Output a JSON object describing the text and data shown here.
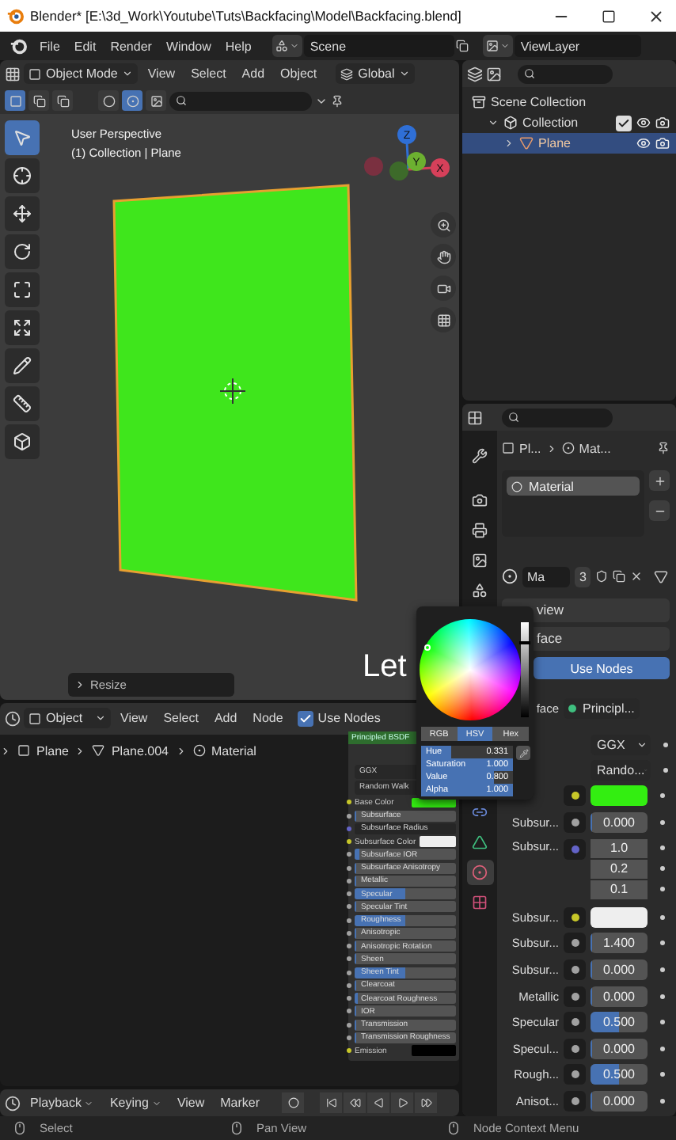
{
  "window": {
    "title": "Blender* [E:\\3d_Work\\Youtube\\Tuts\\Backfacing\\Model\\Backfacing.blend]"
  },
  "top_bar": {
    "menus": [
      "File",
      "Edit",
      "Render",
      "Window",
      "Help"
    ],
    "scene": "Scene",
    "view_layer": "ViewLayer"
  },
  "viewport": {
    "mode": "Object Mode",
    "menus": [
      "View",
      "Select",
      "Add",
      "Object"
    ],
    "orientation": "Global",
    "tools": [
      {
        "kind": "select",
        "selected": true
      },
      {
        "kind": "cursor",
        "selected": false
      },
      {
        "kind": "move",
        "selected": false
      },
      {
        "kind": "rotate",
        "selected": false
      },
      {
        "kind": "scale",
        "selected": false
      },
      {
        "kind": "transform",
        "selected": false
      },
      {
        "kind": "annotate",
        "selected": false
      },
      {
        "kind": "measure",
        "selected": false
      },
      {
        "kind": "add",
        "selected": false
      }
    ],
    "select_modes": [
      {
        "kind": "set",
        "selected": true
      },
      {
        "kind": "extend",
        "selected": false
      },
      {
        "kind": "subtract",
        "selected": false
      }
    ],
    "shading": [
      {
        "kind": "wireframe",
        "selected": false
      },
      {
        "kind": "solid",
        "selected": true
      },
      {
        "kind": "material",
        "selected": false
      }
    ],
    "info": [
      "User Perspective",
      "(1) Collection | Plane"
    ],
    "axes": [
      "Z",
      "Y",
      "X"
    ],
    "last_operator": "Resize",
    "key_overlay": "Let"
  },
  "outliner": {
    "items": [
      {
        "label": "Scene Collection",
        "kind": "scene",
        "selected": false,
        "children": [
          {
            "label": "Collection",
            "kind": "collection",
            "selected": false,
            "expanded": true,
            "checked": true,
            "children": [
              {
                "label": "Plane",
                "kind": "mesh",
                "selected": true,
                "expanded": false
              }
            ]
          }
        ]
      }
    ]
  },
  "properties": {
    "tabs": [
      {
        "kind": "tool",
        "selected": false
      },
      {
        "kind": "render",
        "selected": false
      },
      {
        "kind": "output",
        "selected": false
      },
      {
        "kind": "view_layer",
        "selected": false
      },
      {
        "kind": "scene",
        "selected": false
      },
      {
        "kind": "constraints",
        "selected": false
      },
      {
        "kind": "data",
        "selected": false
      },
      {
        "kind": "material",
        "selected": true
      },
      {
        "kind": "texture",
        "selected": false
      }
    ],
    "breadcrumb": [
      "Pl...",
      "Mat..."
    ],
    "slots": [
      {
        "label": "Material",
        "selected": true
      }
    ],
    "material": {
      "name": "Ma",
      "users": "3"
    },
    "rows": [
      {
        "kind": "panel",
        "label": "view"
      },
      {
        "kind": "panel",
        "label": "face"
      },
      {
        "kind": "button",
        "label": "Use Nodes"
      },
      {
        "kind": "link",
        "label": "face",
        "value": "Principl..."
      },
      {
        "kind": "menu",
        "value": "GGX"
      },
      {
        "kind": "menu",
        "value": "Rando..."
      },
      {
        "kind": "color",
        "color": "#33ee11"
      },
      {
        "kind": "number",
        "label": "Subsur...",
        "value": "0.000",
        "level": 0
      },
      {
        "kind": "vector",
        "label": "Subsur...",
        "values": [
          "1.0",
          "0.2",
          "0.1"
        ]
      },
      {
        "kind": "color",
        "label": "Subsur...",
        "color": "#eeeeee"
      },
      {
        "kind": "number",
        "label": "Subsur...",
        "value": "1.400",
        "level": 0.04
      },
      {
        "kind": "number",
        "label": "Subsur...",
        "value": "0.000",
        "level": 0
      },
      {
        "kind": "number",
        "label": "Metallic",
        "value": "0.000",
        "level": 0
      },
      {
        "kind": "number",
        "label": "Specular",
        "value": "0.500",
        "level": 0.5
      },
      {
        "kind": "number",
        "label": "Specul...",
        "value": "0.000",
        "level": 0
      },
      {
        "kind": "number",
        "label": "Rough...",
        "value": "0.500",
        "level": 0.5
      },
      {
        "kind": "number",
        "label": "Anisot...",
        "value": "0.000",
        "level": 0
      }
    ]
  },
  "color_picker": {
    "tabs": [
      {
        "label": "RGB",
        "selected": false
      },
      {
        "label": "HSV",
        "selected": true
      },
      {
        "label": "Hex",
        "selected": false
      }
    ],
    "fields": [
      {
        "label": "Hue",
        "value": "0.331",
        "level": 0.331
      },
      {
        "label": "Saturation",
        "value": "1.000",
        "level": 1
      },
      {
        "label": "Value",
        "value": "0.800",
        "level": 0.8
      },
      {
        "label": "Alpha",
        "value": "1.000",
        "level": 1
      }
    ]
  },
  "node_editor": {
    "shader": "Object",
    "menus": [
      "View",
      "Select",
      "Add",
      "Node"
    ],
    "use_nodes": {
      "label": "Use Nodes",
      "checked": true
    },
    "breadcrumb": [
      "Plane",
      "Plane.004",
      "Material"
    ],
    "node": {
      "title": "Principled BSDF",
      "menus": [
        "GGX",
        "Random Walk"
      ],
      "inputs": [
        {
          "label": "Base Color",
          "kind": "color",
          "color": "#33ee11"
        },
        {
          "label": "Subsurface",
          "kind": "field",
          "level": 0
        },
        {
          "label": "Subsurface Radius",
          "kind": "vector"
        },
        {
          "label": "Subsurface Color",
          "kind": "color",
          "color": "#eeeeee"
        },
        {
          "label": "Subsurface IOR",
          "kind": "field",
          "level": 0.05
        },
        {
          "label": "Subsurface Anisotropy",
          "kind": "field",
          "level": 0
        },
        {
          "label": "Metallic",
          "kind": "field",
          "level": 0
        },
        {
          "label": "Specular",
          "kind": "field",
          "level": 0.5
        },
        {
          "label": "Specular Tint",
          "kind": "field",
          "level": 0
        },
        {
          "label": "Roughness",
          "kind": "field",
          "level": 0.5
        },
        {
          "label": "Anisotropic",
          "kind": "field",
          "level": 0
        },
        {
          "label": "Anisotropic Rotation",
          "kind": "field",
          "level": 0
        },
        {
          "label": "Sheen",
          "kind": "field",
          "level": 0
        },
        {
          "label": "Sheen Tint",
          "kind": "field",
          "level": 0.5
        },
        {
          "label": "Clearcoat",
          "kind": "field",
          "level": 0
        },
        {
          "label": "Clearcoat Roughness",
          "kind": "field",
          "level": 0.03
        },
        {
          "label": "IOR",
          "kind": "field",
          "level": 0
        },
        {
          "label": "Transmission",
          "kind": "field",
          "level": 0
        },
        {
          "label": "Transmission Roughness",
          "kind": "field",
          "level": 0
        },
        {
          "label": "Emission",
          "kind": "color",
          "color": "#000000"
        }
      ]
    }
  },
  "timeline": {
    "menus": [
      {
        "label": "Playback",
        "kind": "dropdown"
      },
      {
        "label": "Keying",
        "kind": "dropdown"
      },
      {
        "label": "View",
        "kind": "menu"
      },
      {
        "label": "Marker",
        "kind": "menu"
      }
    ]
  },
  "status_bar": [
    "Select",
    "Pan View",
    "Node Context Menu"
  ]
}
